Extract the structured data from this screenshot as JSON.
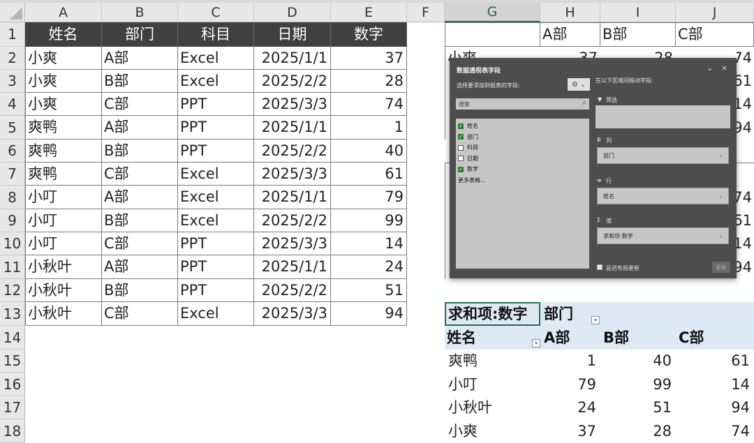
{
  "columns": [
    "A",
    "B",
    "C",
    "D",
    "E",
    "F",
    "G",
    "H",
    "I",
    "J"
  ],
  "rows": [
    "1",
    "2",
    "3",
    "4",
    "5",
    "6",
    "7",
    "8",
    "9",
    "10",
    "11",
    "12",
    "13",
    "14",
    "15",
    "16",
    "17",
    "18"
  ],
  "source_table": {
    "headers": [
      "姓名",
      "部门",
      "科目",
      "日期",
      "数字"
    ],
    "rows": [
      [
        "小爽",
        "A部",
        "Excel",
        "2025/1/1",
        "37"
      ],
      [
        "小爽",
        "B部",
        "Excel",
        "2025/2/2",
        "28"
      ],
      [
        "小爽",
        "C部",
        "PPT",
        "2025/3/3",
        "74"
      ],
      [
        "爽鸭",
        "A部",
        "PPT",
        "2025/1/1",
        "1"
      ],
      [
        "爽鸭",
        "B部",
        "PPT",
        "2025/2/2",
        "40"
      ],
      [
        "爽鸭",
        "C部",
        "Excel",
        "2025/3/3",
        "61"
      ],
      [
        "小叮",
        "A部",
        "Excel",
        "2025/1/1",
        "79"
      ],
      [
        "小叮",
        "B部",
        "Excel",
        "2025/2/2",
        "99"
      ],
      [
        "小叮",
        "C部",
        "PPT",
        "2025/3/3",
        "14"
      ],
      [
        "小秋叶",
        "A部",
        "PPT",
        "2025/1/1",
        "24"
      ],
      [
        "小秋叶",
        "B部",
        "PPT",
        "2025/2/2",
        "51"
      ],
      [
        "小秋叶",
        "C部",
        "Excel",
        "2025/3/3",
        "94"
      ]
    ]
  },
  "small_table_1": {
    "headers": [
      "",
      "A部",
      "B部",
      "C部"
    ],
    "first_name_fragment": "小爽",
    "visible_right_values": [
      "74",
      "61",
      "14",
      "94"
    ],
    "row2_values": [
      "37",
      "28"
    ]
  },
  "small_table_2": {
    "visible_right_values": [
      "74",
      "61",
      "14",
      "94"
    ]
  },
  "pivot": {
    "corner_label": "求和项:数字",
    "col_field": "部门",
    "row_field": "姓名",
    "col_headers": [
      "A部",
      "B部",
      "C部"
    ],
    "rows": [
      {
        "name": "爽鸭",
        "values": [
          "1",
          "40",
          "61"
        ]
      },
      {
        "name": "小叮",
        "values": [
          "79",
          "99",
          "14"
        ]
      },
      {
        "name": "小秋叶",
        "values": [
          "24",
          "51",
          "94"
        ]
      },
      {
        "name": "小爽",
        "values": [
          "37",
          "28",
          "74"
        ]
      }
    ]
  },
  "field_panel": {
    "title": "数据透视表字段",
    "choose_label": "选择要添加到报表的字段:",
    "drag_label": "在以下区域间拖动字段:",
    "search_placeholder": "搜索",
    "fields": [
      {
        "label": "姓名",
        "checked": true
      },
      {
        "label": "部门",
        "checked": true
      },
      {
        "label": "科目",
        "checked": false
      },
      {
        "label": "日期",
        "checked": false
      },
      {
        "label": "数字",
        "checked": true
      }
    ],
    "more_tables": "更多表格...",
    "filter_label": "筛选",
    "columns_label": "列",
    "columns_value": "部门",
    "rows_label": "行",
    "rows_value": "姓名",
    "values_label": "值",
    "values_value": "求和项:数字",
    "defer_label": "延迟布局更新",
    "update_button": "更新",
    "minimize_glyph": "⌄",
    "close_glyph": "×",
    "gear_glyph": "⚙ ⌄",
    "search_glyph": "⌕",
    "filter_glyph": "▼",
    "columns_glyph": "Ⅲ",
    "rows_glyph": "≡",
    "values_glyph": "Σ"
  }
}
